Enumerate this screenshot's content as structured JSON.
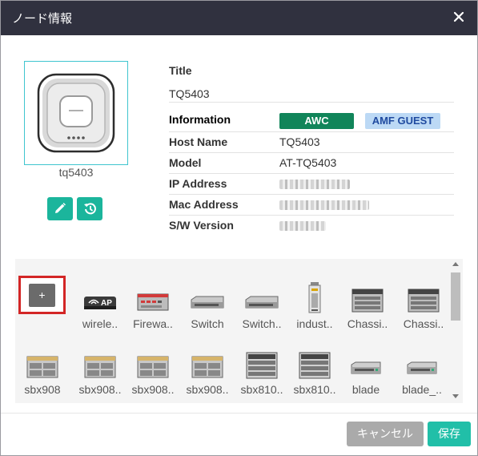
{
  "dialog": {
    "title": "ノード情報"
  },
  "node": {
    "label": "tq5403",
    "icon": "access-point-icon"
  },
  "properties": {
    "title_label": "Title",
    "title_value": "TQ5403",
    "information_label": "Information",
    "badges": {
      "awc": "AWC",
      "amf_guest": "AMF GUEST"
    },
    "host_name_label": "Host Name",
    "host_name_value": "TQ5403",
    "model_label": "Model",
    "model_value": "AT-TQ5403",
    "ip_address_label": "IP Address",
    "mac_address_label": "Mac Address",
    "sw_version_label": "S/W Version"
  },
  "palette": {
    "add_label": "+",
    "items": [
      {
        "label": "wirele..",
        "icon": "wireless-ap-icon"
      },
      {
        "label": "Firewa..",
        "icon": "firewall-icon"
      },
      {
        "label": "Switch",
        "icon": "switch-icon"
      },
      {
        "label": "Switch..",
        "icon": "switch-icon"
      },
      {
        "label": "indust..",
        "icon": "industrial-switch-icon"
      },
      {
        "label": "Chassi..",
        "icon": "chassis-icon"
      },
      {
        "label": "Chassi..",
        "icon": "chassis-icon"
      },
      {
        "label": "sbx908",
        "icon": "sbx908-icon"
      },
      {
        "label": "sbx908..",
        "icon": "sbx908-icon"
      },
      {
        "label": "sbx908..",
        "icon": "sbx908-icon"
      },
      {
        "label": "sbx908..",
        "icon": "sbx908-icon"
      },
      {
        "label": "sbx810..",
        "icon": "sbx810-icon"
      },
      {
        "label": "sbx810..",
        "icon": "sbx810-icon"
      },
      {
        "label": "blade",
        "icon": "blade-icon"
      },
      {
        "label": "blade_..",
        "icon": "blade-icon"
      }
    ]
  },
  "footer": {
    "cancel_label": "キャンセル",
    "save_label": "保存"
  },
  "colors": {
    "titlebar": "#30313f",
    "accent_teal": "#1bb59c",
    "awc_badge": "#11855a",
    "amf_badge": "#bcd9f5",
    "highlight_red": "#d32626"
  }
}
